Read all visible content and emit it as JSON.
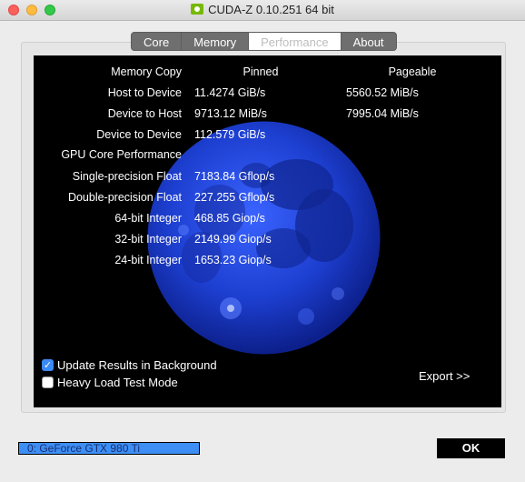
{
  "window": {
    "title": "CUDA-Z 0.10.251 64 bit"
  },
  "tabs": [
    {
      "label": "Core"
    },
    {
      "label": "Memory"
    },
    {
      "label": "Performance"
    },
    {
      "label": "About"
    }
  ],
  "active_tab": "Performance",
  "memory_copy": {
    "heading": "Memory Copy",
    "col_pinned": "Pinned",
    "col_pageable": "Pageable",
    "rows": [
      {
        "label": "Host to Device",
        "pinned": "11.4274 GiB/s",
        "pageable": "5560.52 MiB/s"
      },
      {
        "label": "Device to Host",
        "pinned": "9713.12 MiB/s",
        "pageable": "7995.04 MiB/s"
      },
      {
        "label": "Device to Device",
        "pinned": "112.579 GiB/s"
      }
    ]
  },
  "gpu_core": {
    "heading": "GPU Core Performance",
    "rows": [
      {
        "label": "Single-precision Float",
        "value": "7183.84 Gflop/s"
      },
      {
        "label": "Double-precision Float",
        "value": "227.255 Gflop/s"
      },
      {
        "label": "64-bit Integer",
        "value": "468.85 Giop/s"
      },
      {
        "label": "32-bit Integer",
        "value": "2149.99 Giop/s"
      },
      {
        "label": "24-bit Integer",
        "value": "1653.23 Giop/s"
      }
    ]
  },
  "options": {
    "update_bg": {
      "label": "Update Results in Background",
      "checked": true
    },
    "heavy_load": {
      "label": "Heavy Load Test Mode",
      "checked": false
    }
  },
  "export_label": "Export >>",
  "device_select": "0: GeForce GTX 980 Ti",
  "ok_label": "OK",
  "colors": {
    "accent": "#3b89f5",
    "moon": "#1d3fd0",
    "panel": "#000000"
  }
}
